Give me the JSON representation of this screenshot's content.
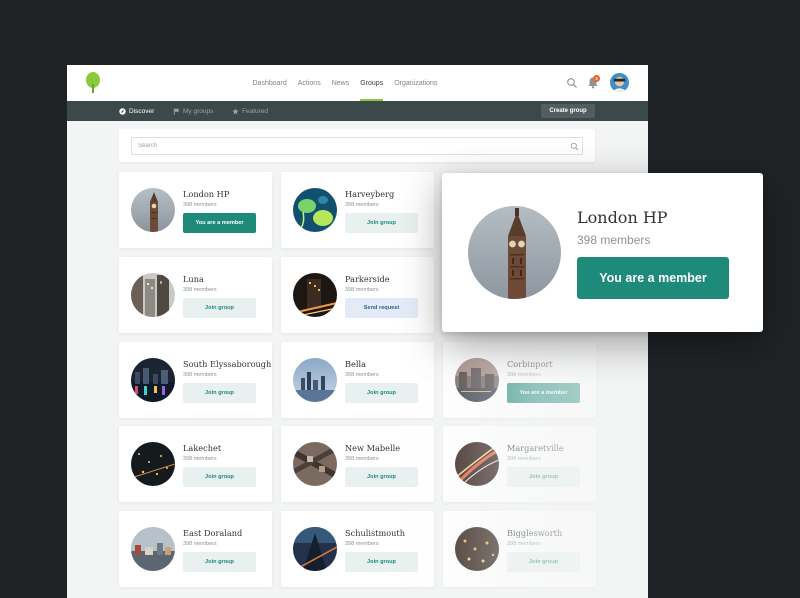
{
  "nav": {
    "links": [
      "Dashboard",
      "Actions",
      "News",
      "Groups",
      "Organizations"
    ],
    "active": "Groups",
    "notification_count": "3"
  },
  "subnav": {
    "tabs": [
      "Discover",
      "My groups",
      "Featured"
    ],
    "create_label": "Create group"
  },
  "search": {
    "placeholder": "Search"
  },
  "groups": [
    {
      "name": "London HP",
      "members": "398 members",
      "button": "You are a member",
      "style": "member"
    },
    {
      "name": "Harveyberg",
      "members": "398 members",
      "button": "Join group",
      "style": "join"
    },
    {
      "name": "Luna",
      "members": "398 members",
      "button": "Join group",
      "style": "join"
    },
    {
      "name": "Parkerside",
      "members": "398 members",
      "button": "Send request",
      "style": "request"
    },
    {
      "name": "South Elyssaborough",
      "members": "398 members",
      "button": "Join group",
      "style": "join"
    },
    {
      "name": "Bella",
      "members": "398 members",
      "button": "Join group",
      "style": "join"
    },
    {
      "name": "Corbinport",
      "members": "398 members",
      "button": "You are a member",
      "style": "member"
    },
    {
      "name": "Lakechet",
      "members": "398 members",
      "button": "Join group",
      "style": "join"
    },
    {
      "name": "New Mabelle",
      "members": "398 members",
      "button": "Join group",
      "style": "join"
    },
    {
      "name": "Margaretville",
      "members": "398 members",
      "button": "Join group",
      "style": "join"
    },
    {
      "name": "East Doraland",
      "members": "398 members",
      "button": "Join group",
      "style": "join"
    },
    {
      "name": "Schulistmouth",
      "members": "398 members",
      "button": "Join group",
      "style": "join"
    },
    {
      "name": "Bigglesworth",
      "members": "398 members",
      "button": "Join group",
      "style": "join"
    }
  ],
  "zoom": {
    "name": "London HP",
    "members": "398 members",
    "button": "You are a member"
  },
  "colors": {
    "accent": "#1d8a7a",
    "nav_active_underline": "#8cc83c",
    "subnav_bg": "#3c4949",
    "notification_badge": "#e8632b"
  }
}
